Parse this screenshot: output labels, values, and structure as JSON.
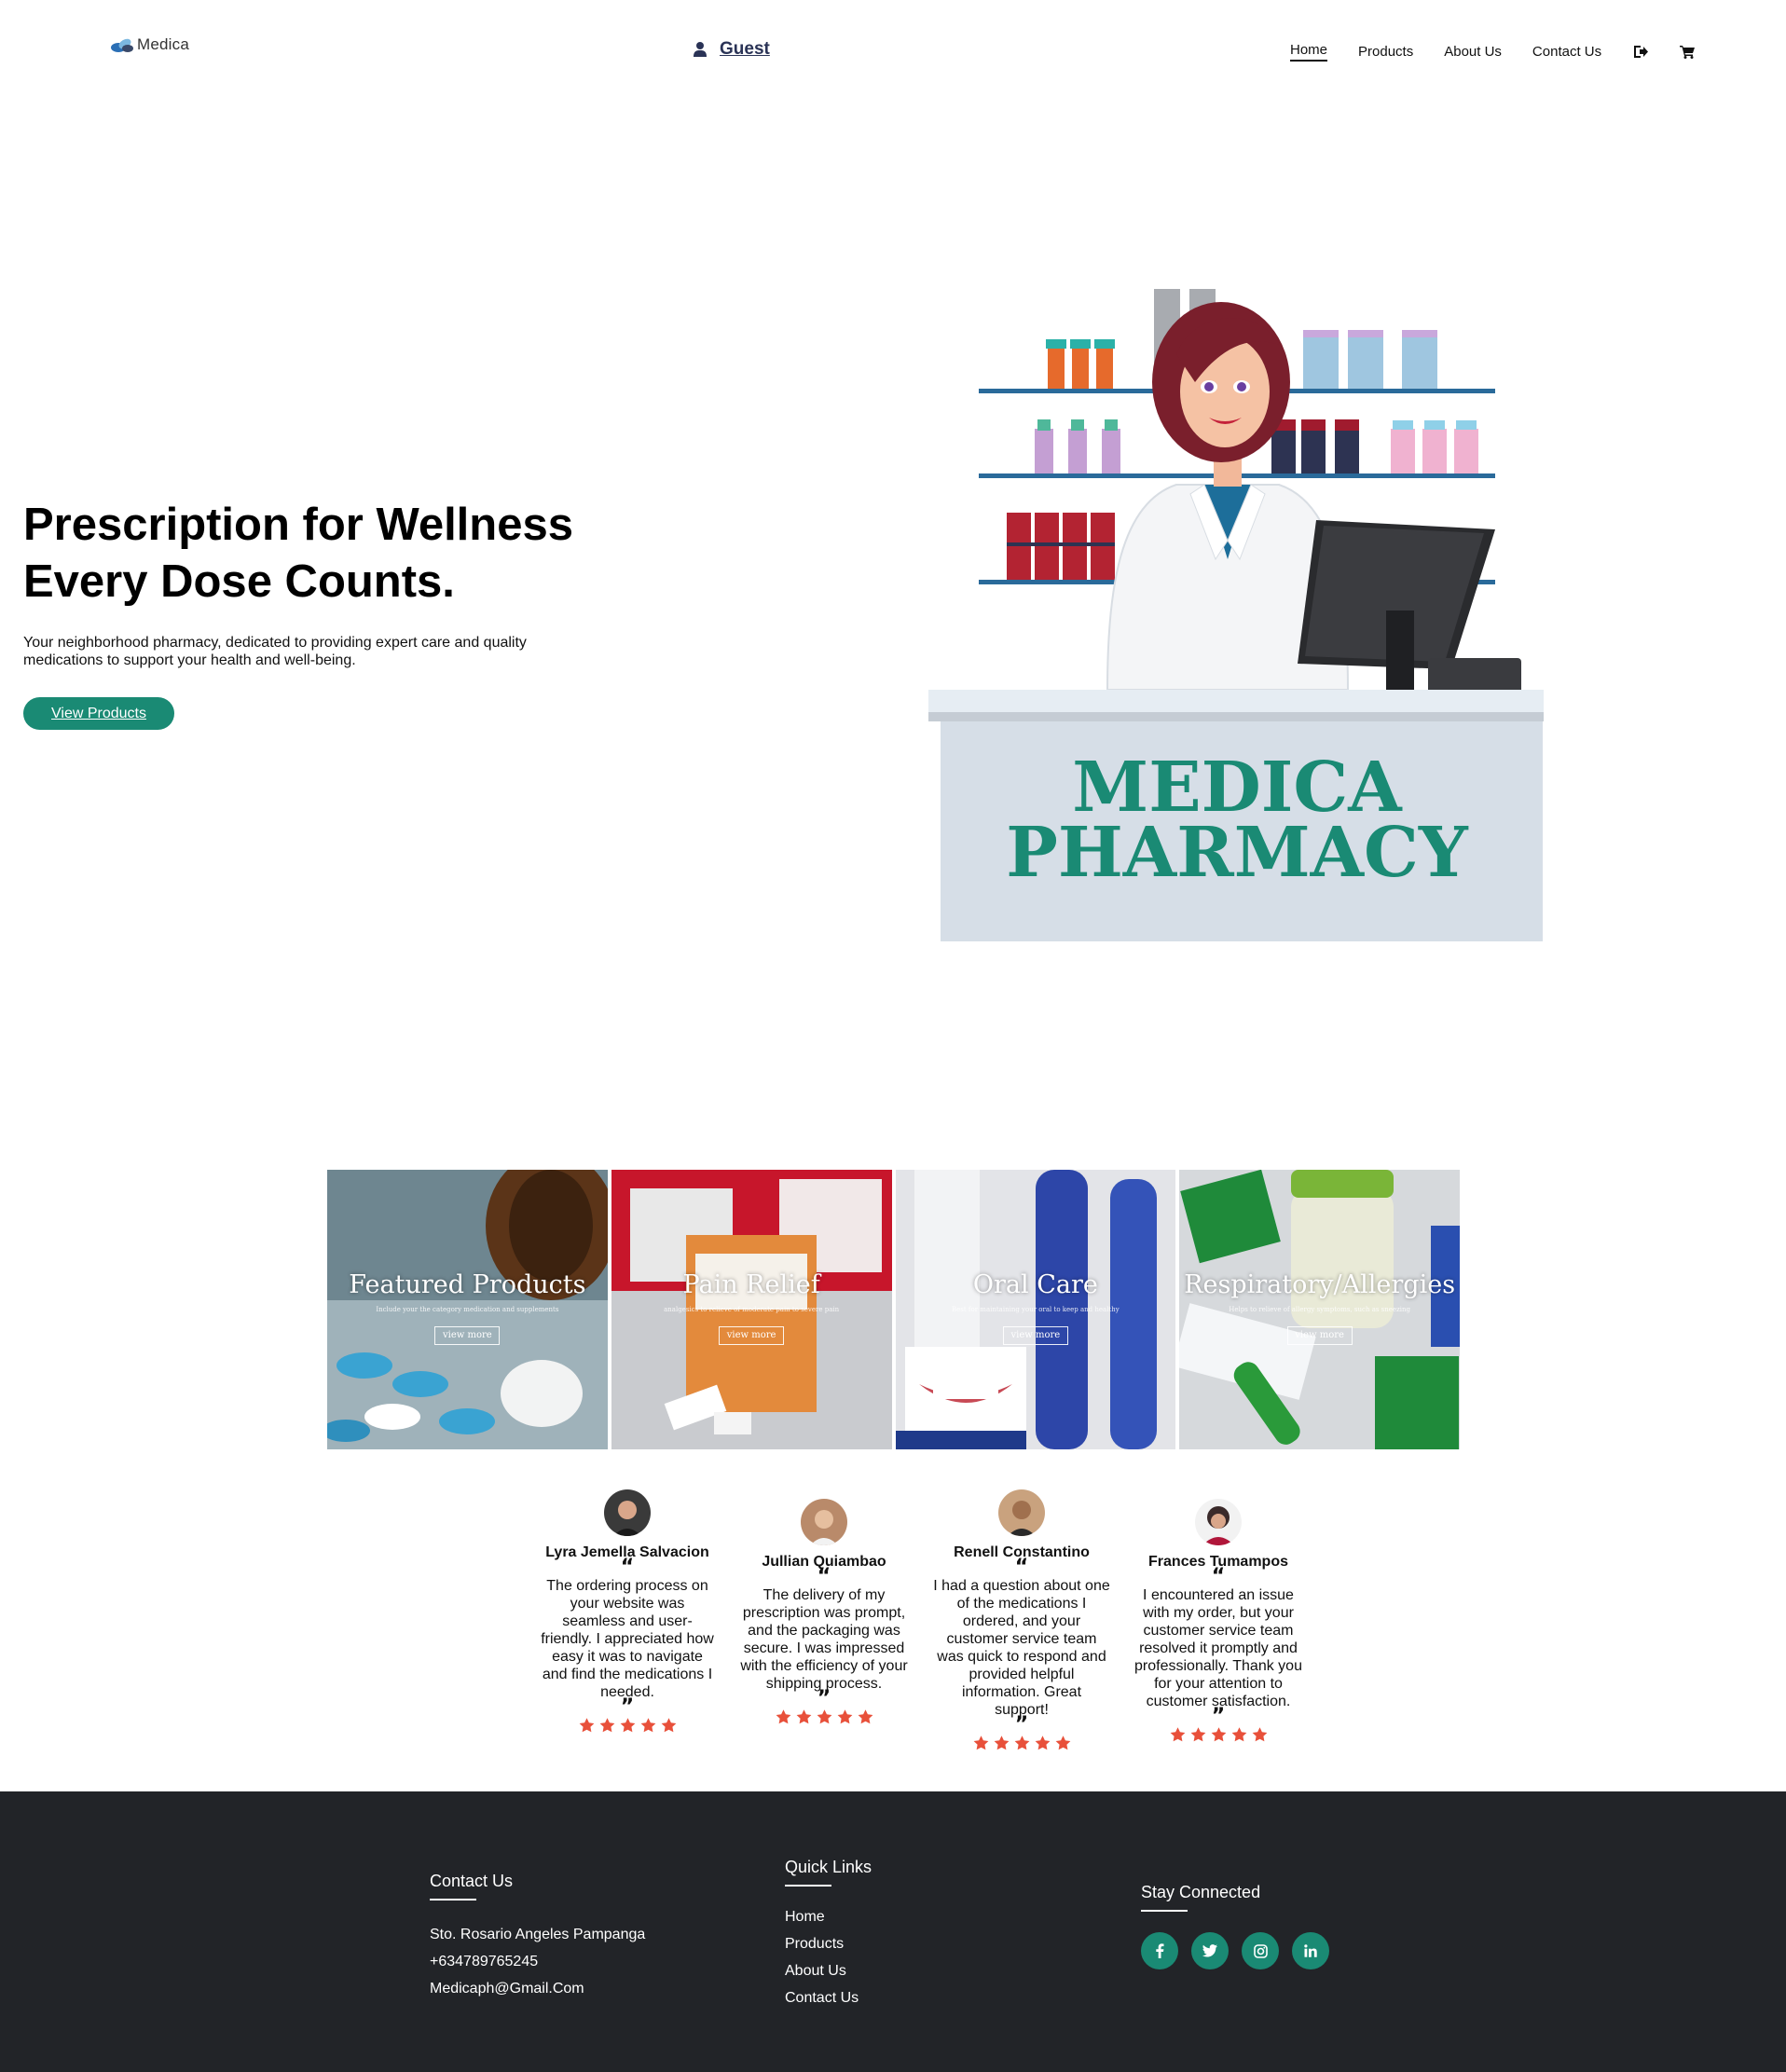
{
  "header": {
    "logo_text": "Medica",
    "guest_label": "Guest",
    "nav": [
      {
        "label": "Home",
        "active": true
      },
      {
        "label": "Products",
        "active": false
      },
      {
        "label": "About Us",
        "active": false
      },
      {
        "label": "Contact Us",
        "active": false
      }
    ],
    "icons": [
      "logout-icon",
      "cart-icon"
    ]
  },
  "hero": {
    "title_line1": "Prescription for Wellness",
    "title_line2": "Every Dose Counts.",
    "subtitle": "Your neighborhood pharmacy, dedicated to providing expert care and quality medications to support your health and well-being.",
    "button_label": "View Products",
    "sign_line1": "MEDICA",
    "sign_line2": "PHARMACY"
  },
  "categories": [
    {
      "title": "Featured Products",
      "desc": "Include your the category medication and supplements",
      "button": "view more"
    },
    {
      "title": "Pain Relief",
      "desc": "analgesics to relieve of moderate pain to severe pain",
      "button": "view more"
    },
    {
      "title": "Oral Care",
      "desc": "Best for maintaining your oral to keep and healthy",
      "button": "view more"
    },
    {
      "title": "Respiratory/Allergies",
      "desc": "Helps to relieve of allergy symptoms, such as sneezing",
      "button": "view more"
    }
  ],
  "reviews": [
    {
      "name": "Lyra Jemella Salvacion",
      "text": "The ordering process on your website was seamless and user-friendly. I appreciated how easy it was to navigate and find the medications I needed.",
      "rating": 5
    },
    {
      "name": "Jullian Quiambao",
      "text": "The delivery of my prescription was prompt, and the packaging was secure. I was impressed with the efficiency of your shipping process.",
      "rating": 5
    },
    {
      "name": "Renell Constantino",
      "text": "I had a question about one of the medications I ordered, and your customer service team was quick to respond and provided helpful information. Great support!",
      "rating": 5
    },
    {
      "name": "Frances Tumampos",
      "text": "I encountered an issue with my order, but your customer service team resolved it promptly and professionally. Thank you for your attention to customer satisfaction.",
      "rating": 5
    }
  ],
  "footer": {
    "contact_title": "Contact Us",
    "address": "Sto. Rosario Angeles Pampanga",
    "phone": "+634789765245",
    "email": "Medicaph@Gmail.Com",
    "links_title": "Quick Links",
    "links": [
      "Home",
      "Products",
      "About Us",
      "Contact Us"
    ],
    "social_title": "Stay Connected",
    "social": [
      "facebook-icon",
      "twitter-icon",
      "instagram-icon",
      "linkedin-icon"
    ]
  },
  "colors": {
    "accent": "#1a8a74",
    "footer_bg": "#222428",
    "star": "#e8503a",
    "shelf": "#2a6a9a"
  }
}
